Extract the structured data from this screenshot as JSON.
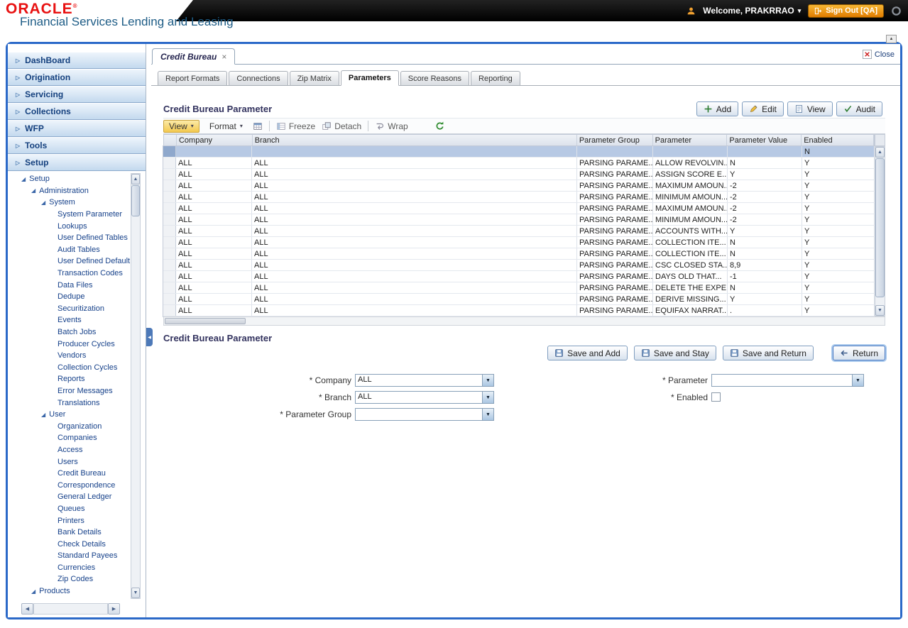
{
  "colors": {
    "oracle_red": "#e81111",
    "frame_blue": "#2b69c8",
    "selected_row": "#b7c9e4",
    "signout_orange": "#e07c00",
    "view_button_highlight": "#f3c94f"
  },
  "icons": {
    "menu_chevron": "▷",
    "tree_expanded": "◢",
    "caret_down": "▾",
    "combo_arrow": "▼",
    "scroll_up": "▲",
    "scroll_down": "▼",
    "scroll_left": "◀",
    "scroll_right": "▶",
    "collapse_left": "◀"
  },
  "header": {
    "brand": "ORACLE",
    "registered_mark": "®",
    "subtitle": "Financial Services Lending and Leasing",
    "welcome": "Welcome, PRAKRRAO",
    "sign_out": "Sign Out [QA]"
  },
  "sidebar": {
    "menu": [
      "DashBoard",
      "Origination",
      "Servicing",
      "Collections",
      "WFP",
      "Tools",
      "Setup"
    ],
    "tree": [
      {
        "label": "Setup",
        "level": 0,
        "expanded": true
      },
      {
        "label": "Administration",
        "level": 1,
        "expanded": true
      },
      {
        "label": "System",
        "level": 2,
        "expanded": true
      },
      {
        "label": "System Parameter",
        "level": 3
      },
      {
        "label": "Lookups",
        "level": 3
      },
      {
        "label": "User Defined Tables",
        "level": 3
      },
      {
        "label": "Audit Tables",
        "level": 3
      },
      {
        "label": "User Defined Default",
        "level": 3
      },
      {
        "label": "Transaction Codes",
        "level": 3
      },
      {
        "label": "Data Files",
        "level": 3
      },
      {
        "label": "Dedupe",
        "level": 3
      },
      {
        "label": "Securitization",
        "level": 3
      },
      {
        "label": "Events",
        "level": 3
      },
      {
        "label": "Batch Jobs",
        "level": 3
      },
      {
        "label": "Producer Cycles",
        "level": 3
      },
      {
        "label": "Vendors",
        "level": 3
      },
      {
        "label": "Collection Cycles",
        "level": 3
      },
      {
        "label": "Reports",
        "level": 3
      },
      {
        "label": "Error Messages",
        "level": 3
      },
      {
        "label": "Translations",
        "level": 3
      },
      {
        "label": "User",
        "level": 2,
        "expanded": true
      },
      {
        "label": "Organization",
        "level": 3
      },
      {
        "label": "Companies",
        "level": 3
      },
      {
        "label": "Access",
        "level": 3
      },
      {
        "label": "Users",
        "level": 3
      },
      {
        "label": "Credit Bureau",
        "level": 3
      },
      {
        "label": "Correspondence",
        "level": 3
      },
      {
        "label": "General Ledger",
        "level": 3
      },
      {
        "label": "Queues",
        "level": 3
      },
      {
        "label": "Printers",
        "level": 3
      },
      {
        "label": "Bank Details",
        "level": 3
      },
      {
        "label": "Check Details",
        "level": 3
      },
      {
        "label": "Standard Payees",
        "level": 3
      },
      {
        "label": "Currencies",
        "level": 3
      },
      {
        "label": "Zip Codes",
        "level": 3
      },
      {
        "label": "Products",
        "level": 1,
        "expanded": true
      }
    ]
  },
  "workspace": {
    "tab_label": "Credit Bureau",
    "tab_close": "×",
    "close_label": "Close",
    "subtabs": [
      "Report Formats",
      "Connections",
      "Zip Matrix",
      "Parameters",
      "Score Reasons",
      "Reporting"
    ],
    "active_subtab": "Parameters"
  },
  "grid_section": {
    "title": "Credit Bureau Parameter",
    "actions": [
      "Add",
      "Edit",
      "View",
      "Audit"
    ],
    "toolbar": {
      "view_label": "View",
      "format_label": "Format",
      "freeze_label": "Freeze",
      "detach_label": "Detach",
      "wrap_label": "Wrap"
    },
    "columns": [
      "Company",
      "Branch",
      "Parameter Group",
      "Parameter",
      "Parameter Value",
      "Enabled"
    ],
    "selected_index": 0,
    "rows": [
      [
        "",
        "",
        "",
        "",
        "",
        "N"
      ],
      [
        "ALL",
        "ALL",
        "PARSING PARAME...",
        "ALLOW REVOLVIN...",
        "N",
        "Y"
      ],
      [
        "ALL",
        "ALL",
        "PARSING PARAME...",
        "ASSIGN SCORE E...",
        "Y",
        "Y"
      ],
      [
        "ALL",
        "ALL",
        "PARSING PARAME...",
        "MAXIMUM AMOUN...",
        "-2",
        "Y"
      ],
      [
        "ALL",
        "ALL",
        "PARSING PARAME...",
        "MINIMUM AMOUN...",
        "-2",
        "Y"
      ],
      [
        "ALL",
        "ALL",
        "PARSING PARAME...",
        "MAXIMUM AMOUN...",
        "-2",
        "Y"
      ],
      [
        "ALL",
        "ALL",
        "PARSING PARAME...",
        "MINIMUM AMOUN...",
        "-2",
        "Y"
      ],
      [
        "ALL",
        "ALL",
        "PARSING PARAME...",
        "ACCOUNTS WITH...",
        "Y",
        "Y"
      ],
      [
        "ALL",
        "ALL",
        "PARSING PARAME...",
        "COLLECTION ITE...",
        "N",
        "Y"
      ],
      [
        "ALL",
        "ALL",
        "PARSING PARAME...",
        "COLLECTION ITE...",
        "N",
        "Y"
      ],
      [
        "ALL",
        "ALL",
        "PARSING PARAME...",
        "CSC CLOSED STA...",
        "8,9",
        "Y"
      ],
      [
        "ALL",
        "ALL",
        "PARSING PARAME...",
        "DAYS OLD THAT...",
        "-1",
        "Y"
      ],
      [
        "ALL",
        "ALL",
        "PARSING PARAME...",
        "DELETE THE EXPE...",
        "N",
        "Y"
      ],
      [
        "ALL",
        "ALL",
        "PARSING PARAME...",
        "DERIVE MISSING...",
        "Y",
        "Y"
      ],
      [
        "ALL",
        "ALL",
        "PARSING PARAME...",
        "EQUIFAX NARRAT...",
        ".",
        "Y"
      ]
    ]
  },
  "form_section": {
    "title": "Credit Bureau Parameter",
    "buttons": [
      "Save and Add",
      "Save and Stay",
      "Save and Return",
      "Return"
    ],
    "required_marker": "*",
    "fields": [
      {
        "label": "Company",
        "value": "ALL"
      },
      {
        "label": "Branch",
        "value": "ALL"
      },
      {
        "label": "Parameter Group",
        "value": ""
      },
      {
        "label": "Parameter",
        "value": ""
      },
      {
        "label": "Enabled",
        "checked": false
      }
    ]
  }
}
